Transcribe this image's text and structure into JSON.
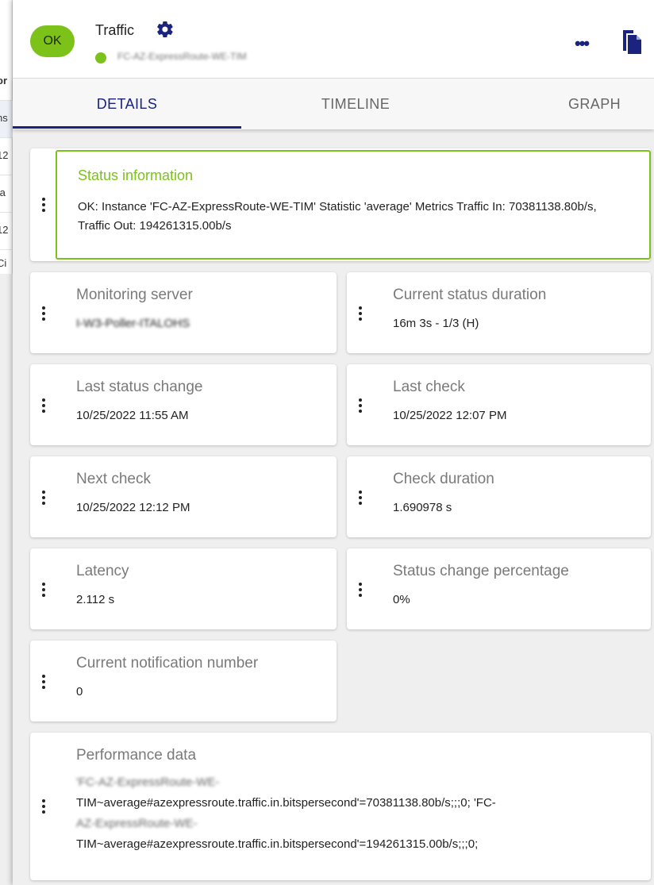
{
  "background_table": {
    "cells": [
      "or",
      "ns",
      "12",
      "ta",
      "12",
      "Ci"
    ]
  },
  "header": {
    "status_badge": "OK",
    "title": "Traffic",
    "host_name": "FC-AZ-ExpressRoute-WE-TIM",
    "host_status_color": "#7cc219"
  },
  "tabs": [
    {
      "label": "DETAILS",
      "active": true
    },
    {
      "label": "TIMELINE",
      "active": false
    },
    {
      "label": "GRAPH",
      "active": false
    }
  ],
  "status_info": {
    "label": "Status information",
    "text": "OK: Instance 'FC-AZ-ExpressRoute-WE-TIM' Statistic 'average' Metrics Traffic In: 70381138.80b/s, Traffic Out: 194261315.00b/s"
  },
  "details": {
    "monitoring_server": {
      "label": "Monitoring server",
      "value": "I-W3-Poller-ITALOHS"
    },
    "current_status_duration": {
      "label": "Current status duration",
      "value": "16m 3s - 1/3 (H)"
    },
    "last_status_change": {
      "label": "Last status change",
      "value": "10/25/2022 11:55 AM"
    },
    "last_check": {
      "label": "Last check",
      "value": "10/25/2022 12:07 PM"
    },
    "next_check": {
      "label": "Next check",
      "value": "10/25/2022 12:12 PM"
    },
    "check_duration": {
      "label": "Check duration",
      "value": "1.690978 s"
    },
    "latency": {
      "label": "Latency",
      "value": "2.112 s"
    },
    "status_change_percentage": {
      "label": "Status change percentage",
      "value": "0%"
    },
    "current_notification_number": {
      "label": "Current notification number",
      "value": "0"
    }
  },
  "performance_data": {
    "label": "Performance data",
    "line1_blurred": "'FC-AZ-ExpressRoute-WE-",
    "line2": "TIM~average#azexpressroute.traffic.in.bitspersecond'=70381138.80b/s;;;0; 'FC-",
    "line3_blurred": "AZ-ExpressRoute-WE-",
    "line4": "TIM~average#azexpressroute.traffic.in.bitspersecond'=194261315.00b/s;;;0;"
  },
  "colors": {
    "ok_green": "#7cc219",
    "primary_navy": "#1a237e"
  }
}
